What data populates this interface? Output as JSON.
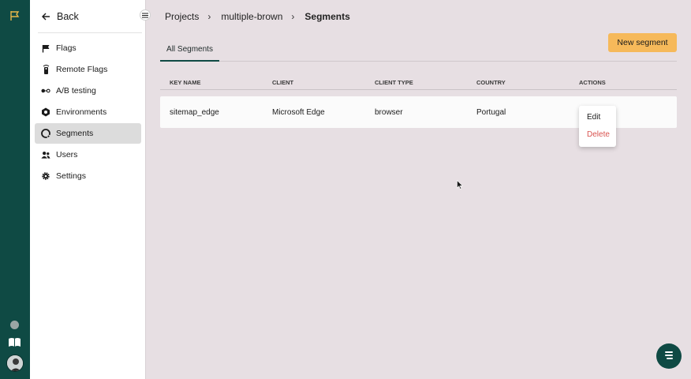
{
  "rail": {
    "logo_icon": "flag-outline-icon",
    "status_icon": "status-dot-icon",
    "docs_icon": "book-icon",
    "avatar_icon": "user-avatar"
  },
  "sidebar": {
    "back_label": "Back",
    "items": [
      {
        "label": "Flags",
        "icon": "flag-icon",
        "active": false
      },
      {
        "label": "Remote Flags",
        "icon": "remote-icon",
        "active": false
      },
      {
        "label": "A/B testing",
        "icon": "ab-testing-icon",
        "active": false
      },
      {
        "label": "Environments",
        "icon": "environments-icon",
        "active": false
      },
      {
        "label": "Segments",
        "icon": "segments-icon",
        "active": true
      },
      {
        "label": "Users",
        "icon": "users-icon",
        "active": false
      },
      {
        "label": "Settings",
        "icon": "gear-icon",
        "active": false
      }
    ]
  },
  "breadcrumb": {
    "items": [
      "Projects",
      "multiple-brown",
      "Segments"
    ]
  },
  "toolbar": {
    "new_segment_label": "New segment"
  },
  "tabs": [
    {
      "label": "All Segments",
      "active": true
    }
  ],
  "table": {
    "columns": [
      "KEY NAME",
      "CLIENT",
      "CLIENT TYPE",
      "COUNTRY",
      "ACTIONS"
    ],
    "rows": [
      {
        "key_name": "sitemap_edge",
        "client": "Microsoft Edge",
        "client_type": "browser",
        "country": "Portugal"
      }
    ]
  },
  "actions_menu": {
    "edit_label": "Edit",
    "delete_label": "Delete"
  },
  "colors": {
    "rail": "#0f4a44",
    "accent_button": "#f6b95a",
    "background": "#e7dfe3",
    "delete": "#d9534f"
  }
}
